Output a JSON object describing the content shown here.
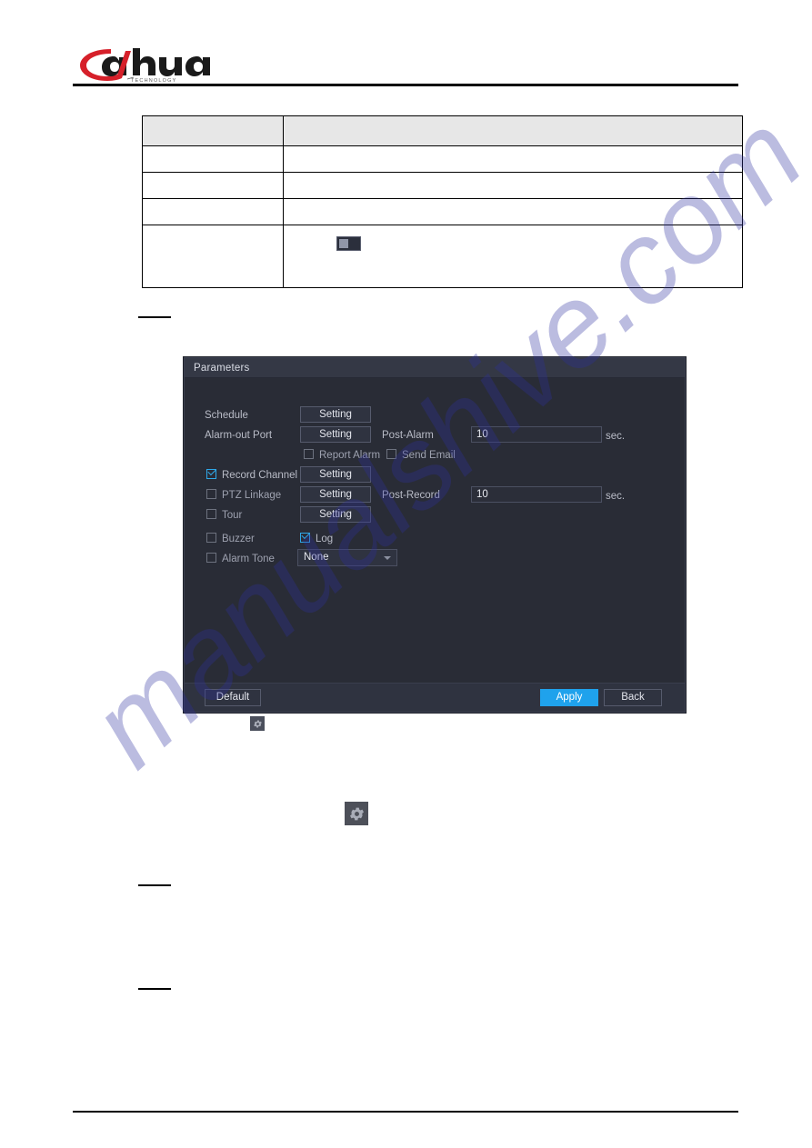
{
  "header": {
    "brand": "alhua",
    "brand_sub": "TECHNOLOGY"
  },
  "spec_table": {
    "columns": [
      "",
      ""
    ],
    "rows": [
      {
        "name": "",
        "description": "",
        "is_header": true
      },
      {
        "name": "",
        "description": ""
      },
      {
        "name": "",
        "description": ""
      },
      {
        "name": "",
        "description": ""
      },
      {
        "name": "",
        "description": "",
        "icon": "toggle-switch-icon"
      }
    ]
  },
  "dialog": {
    "title": "Parameters",
    "fields": {
      "schedule_label": "Schedule",
      "schedule_button": "Setting",
      "alarm_out_port_label": "Alarm-out Port",
      "alarm_out_port_button": "Setting",
      "post_alarm_label": "Post-Alarm",
      "post_alarm_value": "10",
      "post_alarm_unit": "sec.",
      "report_alarm_label": "Report Alarm",
      "report_alarm_checked": false,
      "send_email_label": "Send Email",
      "send_email_checked": false,
      "record_channel_label": "Record Channel",
      "record_channel_checked": true,
      "record_channel_button": "Setting",
      "ptz_linkage_label": "PTZ Linkage",
      "ptz_linkage_checked": false,
      "ptz_linkage_button": "Setting",
      "post_record_label": "Post-Record",
      "post_record_value": "10",
      "post_record_unit": "sec.",
      "tour_label": "Tour",
      "tour_checked": false,
      "tour_button": "Setting",
      "buzzer_label": "Buzzer",
      "buzzer_checked": false,
      "log_label": "Log",
      "log_checked": true,
      "alarm_tone_label": "Alarm Tone",
      "alarm_tone_checked": false,
      "alarm_tone_value": "None"
    },
    "footer": {
      "default_button": "Default",
      "apply_button": "Apply",
      "back_button": "Back"
    },
    "colors": {
      "accent": "#1fa2ec",
      "panel_bg": "#292c36",
      "titlebar_bg": "#343845",
      "checkbox_on": "#2fa8e8"
    }
  },
  "icons": {
    "inline_gear_small": "gear-icon",
    "inline_gear_large": "gear-icon"
  },
  "watermark": {
    "text": "manualshive.com"
  }
}
